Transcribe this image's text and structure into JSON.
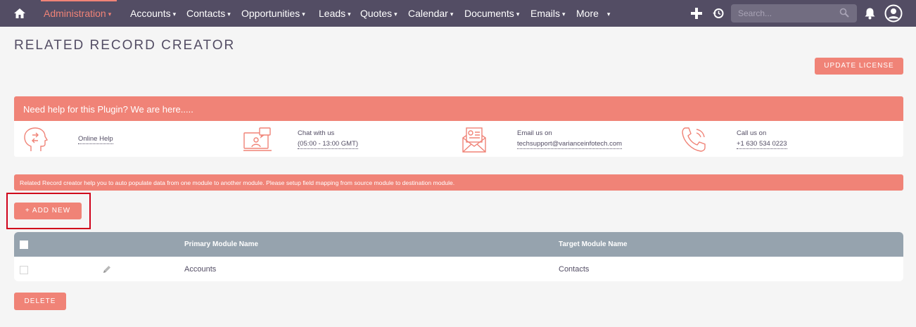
{
  "nav": {
    "items": [
      {
        "label": "Administration",
        "active": true
      },
      {
        "label": "Accounts"
      },
      {
        "label": "Contacts"
      },
      {
        "label": "Opportunities"
      },
      {
        "label": "Leads"
      },
      {
        "label": "Quotes"
      },
      {
        "label": "Calendar"
      },
      {
        "label": "Documents"
      },
      {
        "label": "Emails"
      },
      {
        "label": "More"
      }
    ],
    "search_placeholder": "Search...",
    "icons": [
      "home-icon",
      "plus-icon",
      "history-icon",
      "search-icon",
      "bell-icon",
      "user-icon"
    ]
  },
  "page": {
    "title": "RELATED RECORD CREATOR",
    "update_license": "UPDATE LICENSE"
  },
  "help": {
    "header": "Need help for this Plugin? We are here.....",
    "online_help": "Online Help",
    "chat_label": "Chat with us",
    "chat_hours": "(05:00 - 13:00 GMT)",
    "email_label": "Email us on",
    "email_value": "techsupport@varianceinfotech.com",
    "call_label": "Call us on",
    "call_value": "+1 630 534 0223"
  },
  "info": "Related Record creator help you to auto populate data from one module to another module. Please setup field mapping from source module to destination module.",
  "actions": {
    "add_new": "+ ADD NEW",
    "delete": "DELETE"
  },
  "table": {
    "headers": {
      "primary": "Primary Module Name",
      "target": "Target Module Name"
    },
    "rows": [
      {
        "primary": "Accounts",
        "target": "Contacts"
      }
    ]
  },
  "colors": {
    "nav_bg": "#534d64",
    "accent": "#f08377",
    "table_head": "#96a3ae",
    "highlight": "#d0021b"
  }
}
